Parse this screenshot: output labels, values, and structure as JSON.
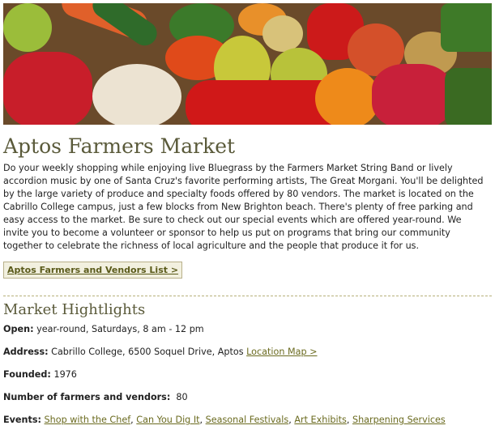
{
  "banner": {
    "alt": "fresh produce banner"
  },
  "title": "Aptos Farmers Market",
  "intro": "Do your weekly shopping while enjoying live Bluegrass by the Farmers Market String Band or lively accordion music by one of Santa Cruz's favorite performing artists, The Great Morgani. You'll be delighted by the large variety of produce and specialty foods offered by 80 vendors. The market is located on the Cabrillo College campus, just a few blocks from New Brighton beach. There's plenty of free parking and easy access to the market. Be sure to check out our special events which are offered year-round. We invite you to become a volunteer or sponsor to help us put on programs that bring our community together to celebrate the richness of local agriculture and the people that produce it for us.",
  "vendors_button": "Aptos Farmers and Vendors List >",
  "highlights": {
    "title": "Market Hightlights",
    "open_label": "Open:",
    "open_value": " year-round, Saturdays, 8 am - 12 pm",
    "address_label": "Address:",
    "address_value": " Cabrillo College, 6500 Soquel Drive, Aptos ",
    "location_map_link": "Location Map >",
    "founded_label": "Founded:",
    "founded_value": " 1976",
    "vendors_label": "Number of farmers and vendors:",
    "vendors_value": "  80",
    "events_label": "Events:",
    "events": [
      "Shop with the Chef",
      "Can You Dig It",
      "Seasonal Festivals",
      "Art Exhibits",
      "Sharpening Services"
    ]
  },
  "colors": {
    "heading": "#5a5a3a",
    "link": "#6b6b20",
    "button_bg": "#f2f0df",
    "divider": "#b7b07a"
  }
}
